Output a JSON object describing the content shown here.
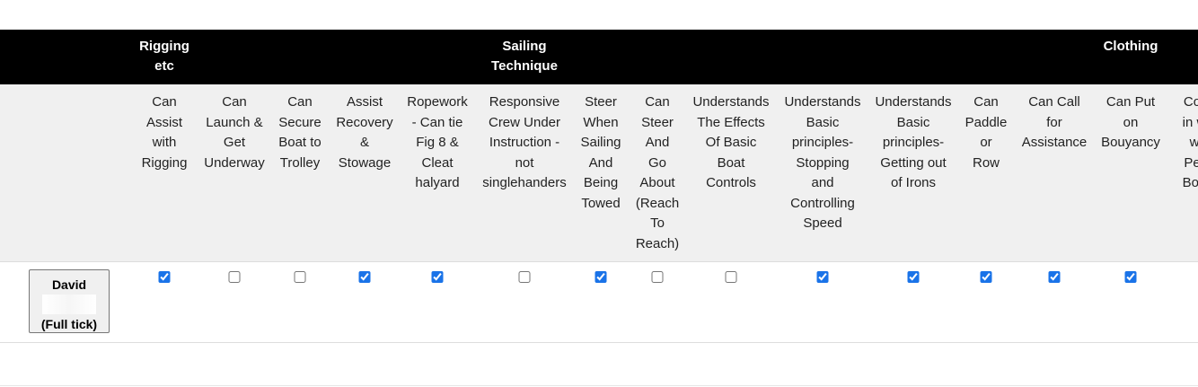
{
  "categories": [
    {
      "id": "rigging",
      "label": "Rigging\netc"
    },
    {
      "id": "sailing",
      "label": "Sailing\nTechnique"
    },
    {
      "id": "clothing",
      "label": "Clothing"
    }
  ],
  "columns": [
    {
      "label": "Can\nAssist\nwith\nRigging"
    },
    {
      "label": "Can\nLaunch &\nGet\nUnderway"
    },
    {
      "label": "Can\nSecure\nBoat to\nTrolley"
    },
    {
      "label": "Assist\nRecovery\n&\nStowage"
    },
    {
      "label": "Ropework\n- Can tie\nFig 8 &\nCleat\nhalyard"
    },
    {
      "label": "Responsive\nCrew Under\nInstruction -\nnot\nsinglehanders"
    },
    {
      "label": "Steer\nWhen\nSailing\nAnd\nBeing\nTowed"
    },
    {
      "label": "Can\nSteer\nAnd\nGo\nAbout\n(Reach\nTo\nReach)"
    },
    {
      "label": "Understands\nThe Effects\nOf Basic\nBoat\nControls"
    },
    {
      "label": "Understands\nBasic\nprinciples-\nStopping\nand\nControlling\nSpeed"
    },
    {
      "label": "Understands\nBasic\nprinciples-\nGetting out\nof Irons"
    },
    {
      "label": "Can\nPaddle\nor\nRow"
    },
    {
      "label": "Can Call\nfor\nAssistance"
    },
    {
      "label": "Can Put\non\nBouyancy"
    },
    {
      "label": "Cor\nin w\nw\nPer\nBou"
    }
  ],
  "row": {
    "name": "David",
    "status": "(Full tick)",
    "checks": [
      true,
      false,
      false,
      true,
      true,
      false,
      true,
      false,
      false,
      true,
      true,
      true,
      true,
      true
    ]
  }
}
